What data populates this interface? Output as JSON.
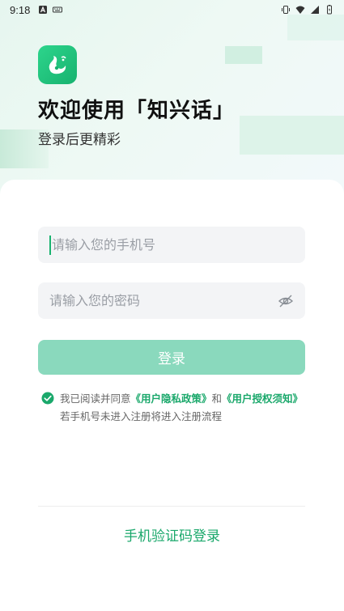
{
  "status_bar": {
    "time": "9:18",
    "left_icons": [
      "a-notification-icon",
      "keyboard-icon"
    ],
    "right_icons": [
      "vibrate-icon",
      "wifi-icon",
      "signal-icon",
      "battery-icon"
    ]
  },
  "header": {
    "logo_icon": "swan-logo-icon",
    "title": "欢迎使用「知兴话」",
    "subtitle": "登录后更精彩"
  },
  "form": {
    "phone_placeholder": "请输入您的手机号",
    "phone_value": "",
    "password_placeholder": "请输入您的密码",
    "password_value": "",
    "login_label": "登录"
  },
  "agreement": {
    "checked": true,
    "prefix": "我已阅读并同意",
    "privacy_link": "《用户隐私政策》",
    "conjunction": "和",
    "auth_link": "《用户授权须知》",
    "suffix": "若手机号未进入注册将进入注册流程"
  },
  "alt_login": {
    "sms_label": "手机验证码登录"
  },
  "colors": {
    "accent": "#1aa86b",
    "button_disabled": "#8ad9bd",
    "field_bg": "#f3f4f6"
  }
}
